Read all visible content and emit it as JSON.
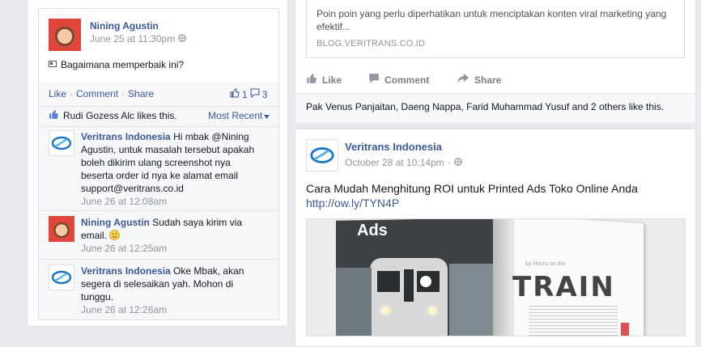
{
  "left_post": {
    "author": "Nining Agustin",
    "time": "June 25 at 11:30pm",
    "text": "Bagaimana memperbaik ini?",
    "actions": {
      "like": "Like",
      "comment": "Comment",
      "share": "Share",
      "sep": "·"
    },
    "like_count": "1",
    "comment_count": "3",
    "likes_text": "Rudi Gozess Alc likes this.",
    "sort_label": "Most Recent",
    "comments": [
      {
        "author": "Veritrans Indonesia",
        "text": "Hi mbak @Nining Agustin, untuk masalah tersebut apakah boleh dikirim ulang screenshot nya beserta order id nya ke alamat email support@veritrans.co.id",
        "time": "June 26 at 12:08am",
        "avatar": "veritrans-logo"
      },
      {
        "author": "Nining Agustin",
        "text": "Sudah saya kirim via email.",
        "time": "June 26 at 12:25am",
        "avatar": "child-photo"
      },
      {
        "author": "Veritrans Indonesia",
        "text": "Oke Mbak, akan segera di selesaikan yah. Mohon di tunggu.",
        "time": "June 26 at 12:26am",
        "avatar": "veritrans-logo"
      }
    ]
  },
  "right_top": {
    "link_desc": "Poin poin yang perlu diperhatikan untuk menciptakan konten viral marketing yang efektif...",
    "link_domain": "BLOG.VERITRANS.CO.ID",
    "actions": {
      "like": "Like",
      "comment": "Comment",
      "share": "Share"
    },
    "likes_text": "Pak Venus Panjaitan, Daeng Nappa, Farid Muhammad Yusuf and 2 others like this."
  },
  "right_post": {
    "author": "Veritrans Indonesia",
    "time": "October 28 at 10:14pm",
    "text": "Cara Mudah Menghitung ROI untuk Printed Ads Toko Online Anda",
    "link": "http://ow.ly/TYN4P",
    "image": {
      "left_heading": "Ads",
      "right_title": "TRAIN",
      "right_kicker": "by Hours on the"
    }
  },
  "colors": {
    "link": "#3b5998",
    "bg": "#e9eaed",
    "meta": "#90949c"
  },
  "icons": [
    "globe-icon",
    "page-icon",
    "thumbs-up-icon",
    "comment-icon",
    "share-icon",
    "smiley-icon",
    "veritrans-logo"
  ]
}
